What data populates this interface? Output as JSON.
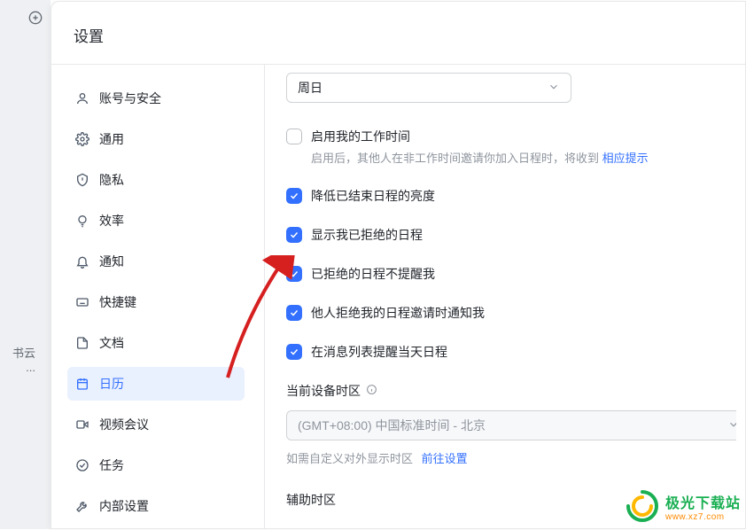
{
  "left_strip": {
    "cloud_label": "书云 ..."
  },
  "title": "设置",
  "sidebar": {
    "items": [
      {
        "label": "账号与安全"
      },
      {
        "label": "通用"
      },
      {
        "label": "隐私"
      },
      {
        "label": "效率"
      },
      {
        "label": "通知"
      },
      {
        "label": "快捷键"
      },
      {
        "label": "文档"
      },
      {
        "label": "日历"
      },
      {
        "label": "视频会议"
      },
      {
        "label": "任务"
      },
      {
        "label": "内部设置"
      }
    ]
  },
  "content": {
    "week_start": "周日",
    "work_hours": {
      "label": "启用我的工作时间",
      "desc_before": "启用后，其他人在非工作时间邀请你加入日程时，将收到 ",
      "desc_link": "相应提示"
    },
    "opt_dim": "降低已结束日程的亮度",
    "opt_show_declined": "显示我已拒绝的日程",
    "opt_no_remind": "已拒绝的日程不提醒我",
    "opt_notify_decline": "他人拒绝我的日程邀请时通知我",
    "opt_msg_remind": "在消息列表提醒当天日程",
    "tz_label": "当前设备时区",
    "tz_value": "(GMT+08:00) 中国标准时间 - 北京",
    "tz_hint": "如需自定义对外显示时区",
    "tz_hint_link": "前往设置",
    "aux_tz_label": "辅助时区"
  },
  "watermark": {
    "line1": "极光下载站",
    "line2": "www.xz7.com"
  }
}
